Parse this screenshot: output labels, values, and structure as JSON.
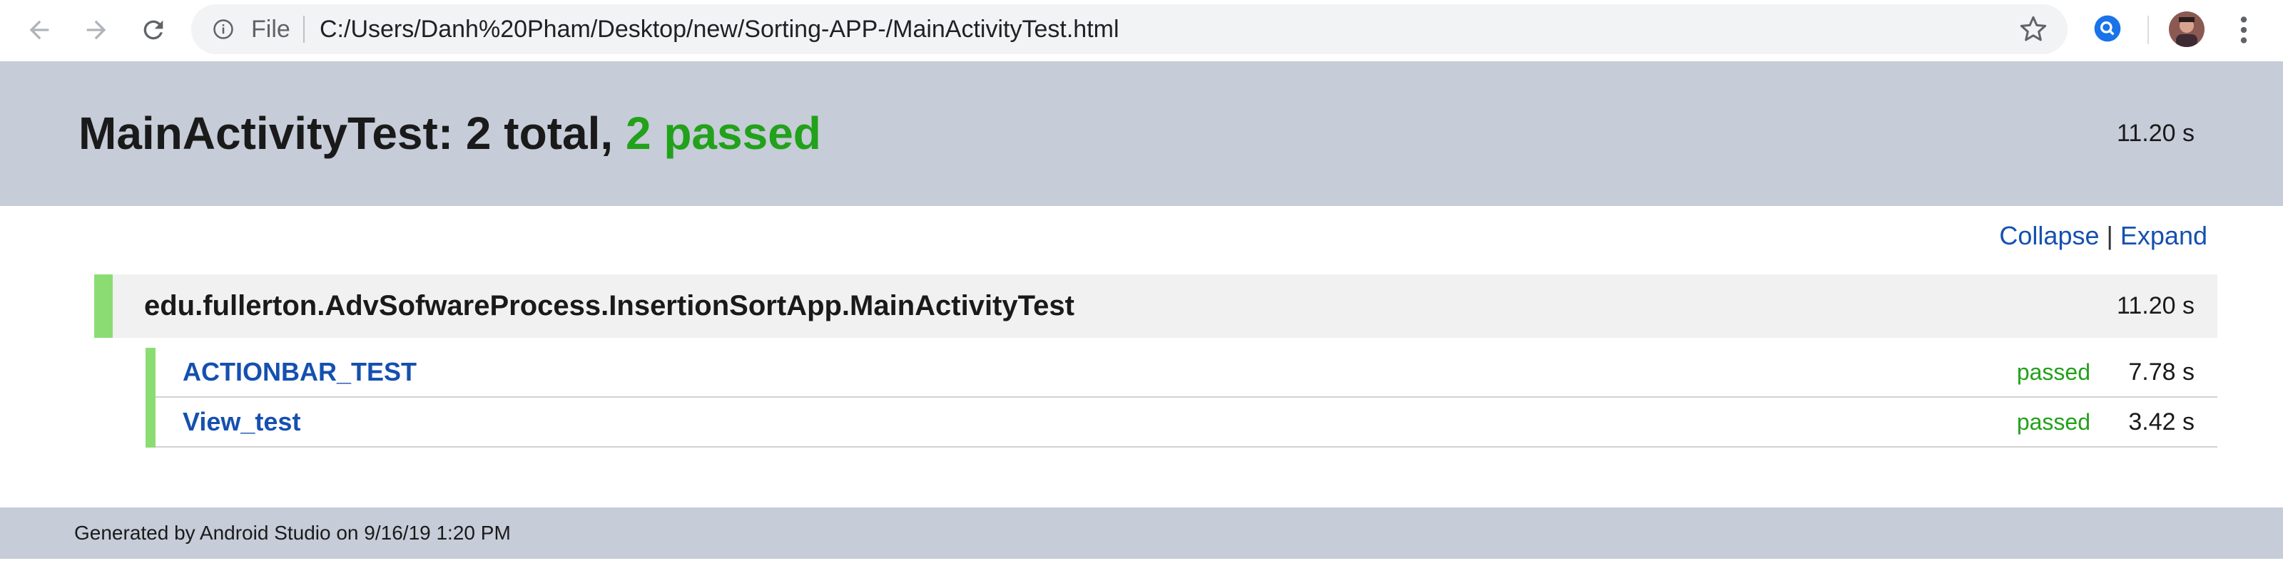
{
  "browser": {
    "file_label": "File",
    "url": "C:/Users/Danh%20Pham/Desktop/new/Sorting-APP-/MainActivityTest.html",
    "icons": {
      "back": "back-arrow-icon",
      "forward": "forward-arrow-icon",
      "reload": "reload-icon",
      "info": "info-icon",
      "bookmark": "star-icon",
      "extension": "search-extension-icon",
      "profile": "avatar",
      "menu": "kebab-menu-icon"
    }
  },
  "report": {
    "title_prefix": "MainActivityTest: 2 total, ",
    "title_passed": "2 passed",
    "duration": "11.20 s",
    "collapse_label": "Collapse",
    "separator": "|",
    "expand_label": "Expand"
  },
  "suite": {
    "name": "edu.fullerton.AdvSofwareProcess.InsertionSortApp.MainActivityTest",
    "duration": "11.20 s"
  },
  "tests": [
    {
      "name": "ACTIONBAR_TEST",
      "status": "passed",
      "duration": "7.78 s"
    },
    {
      "name": "View_test",
      "status": "passed",
      "duration": "3.42 s"
    }
  ],
  "footer": {
    "text": "Generated by Android Studio on 9/16/19 1:20 PM"
  },
  "colors": {
    "header_bg": "#c6ccd8",
    "passed_green": "#22a11a",
    "status_bar_green": "#8bdd73",
    "link_blue": "#1550b0"
  }
}
